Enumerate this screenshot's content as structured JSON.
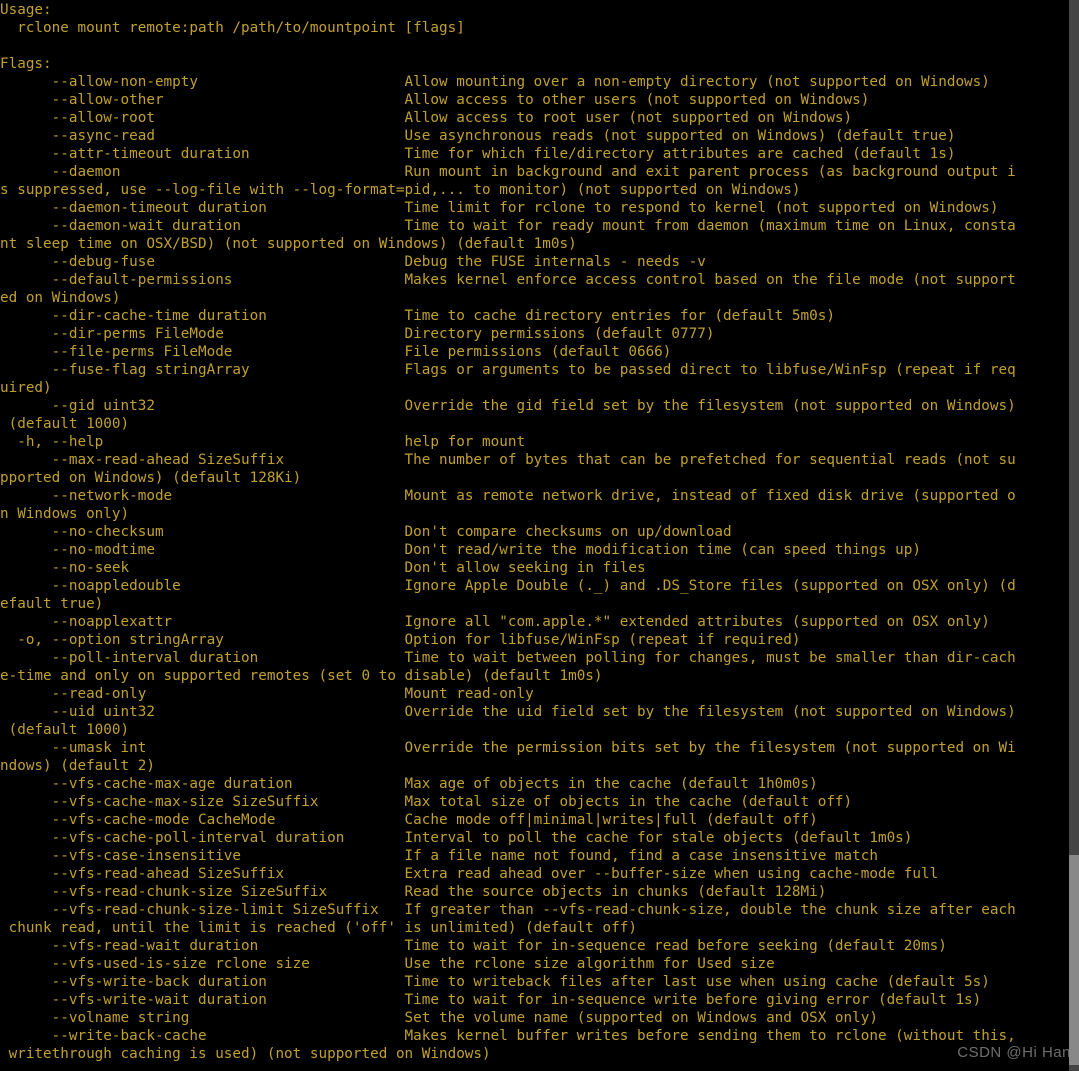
{
  "usage_header": "Usage:",
  "usage_body": "  rclone mount remote:path /path/to/mountpoint [flags]",
  "flags_header": "Flags:",
  "flags": [
    {
      "opt": "      --allow-non-empty",
      "desc": "Allow mounting over a non-empty directory (not supported on Windows)"
    },
    {
      "opt": "      --allow-other",
      "desc": "Allow access to other users (not supported on Windows)"
    },
    {
      "opt": "      --allow-root",
      "desc": "Allow access to root user (not supported on Windows)"
    },
    {
      "opt": "      --async-read",
      "desc": "Use asynchronous reads (not supported on Windows) (default true)"
    },
    {
      "opt": "      --attr-timeout duration",
      "desc": "Time for which file/directory attributes are cached (default 1s)"
    },
    {
      "opt": "      --daemon",
      "desc": "Run mount in background and exit parent process (as background output is suppressed, use --log-file with --log-format=pid,... to monitor) (not supported on Windows)"
    },
    {
      "opt": "      --daemon-timeout duration",
      "desc": "Time limit for rclone to respond to kernel (not supported on Windows)"
    },
    {
      "opt": "      --daemon-wait duration",
      "desc": "Time to wait for ready mount from daemon (maximum time on Linux, constant sleep time on OSX/BSD) (not supported on Windows) (default 1m0s)"
    },
    {
      "opt": "      --debug-fuse",
      "desc": "Debug the FUSE internals - needs -v"
    },
    {
      "opt": "      --default-permissions",
      "desc": "Makes kernel enforce access control based on the file mode (not supported on Windows)"
    },
    {
      "opt": "      --dir-cache-time duration",
      "desc": "Time to cache directory entries for (default 5m0s)"
    },
    {
      "opt": "      --dir-perms FileMode",
      "desc": "Directory permissions (default 0777)"
    },
    {
      "opt": "      --file-perms FileMode",
      "desc": "File permissions (default 0666)"
    },
    {
      "opt": "      --fuse-flag stringArray",
      "desc": "Flags or arguments to be passed direct to libfuse/WinFsp (repeat if required)"
    },
    {
      "opt": "      --gid uint32",
      "desc": "Override the gid field set by the filesystem (not supported on Windows) (default 1000)"
    },
    {
      "opt": "  -h, --help",
      "desc": "help for mount"
    },
    {
      "opt": "      --max-read-ahead SizeSuffix",
      "desc": "The number of bytes that can be prefetched for sequential reads (not supported on Windows) (default 128Ki)"
    },
    {
      "opt": "      --network-mode",
      "desc": "Mount as remote network drive, instead of fixed disk drive (supported on Windows only)"
    },
    {
      "opt": "      --no-checksum",
      "desc": "Don't compare checksums on up/download"
    },
    {
      "opt": "      --no-modtime",
      "desc": "Don't read/write the modification time (can speed things up)"
    },
    {
      "opt": "      --no-seek",
      "desc": "Don't allow seeking in files"
    },
    {
      "opt": "      --noappledouble",
      "desc": "Ignore Apple Double (._) and .DS_Store files (supported on OSX only) (default true)"
    },
    {
      "opt": "      --noapplexattr",
      "desc": "Ignore all \"com.apple.*\" extended attributes (supported on OSX only)"
    },
    {
      "opt": "  -o, --option stringArray",
      "desc": "Option for libfuse/WinFsp (repeat if required)"
    },
    {
      "opt": "      --poll-interval duration",
      "desc": "Time to wait between polling for changes, must be smaller than dir-cache-time and only on supported remotes (set 0 to disable) (default 1m0s)"
    },
    {
      "opt": "      --read-only",
      "desc": "Mount read-only"
    },
    {
      "opt": "      --uid uint32",
      "desc": "Override the uid field set by the filesystem (not supported on Windows) (default 1000)"
    },
    {
      "opt": "      --umask int",
      "desc": "Override the permission bits set by the filesystem (not supported on Windows) (default 2)"
    },
    {
      "opt": "      --vfs-cache-max-age duration",
      "desc": "Max age of objects in the cache (default 1h0m0s)"
    },
    {
      "opt": "      --vfs-cache-max-size SizeSuffix",
      "desc": "Max total size of objects in the cache (default off)"
    },
    {
      "opt": "      --vfs-cache-mode CacheMode",
      "desc": "Cache mode off|minimal|writes|full (default off)"
    },
    {
      "opt": "      --vfs-cache-poll-interval duration",
      "desc": "Interval to poll the cache for stale objects (default 1m0s)"
    },
    {
      "opt": "      --vfs-case-insensitive",
      "desc": "If a file name not found, find a case insensitive match"
    },
    {
      "opt": "      --vfs-read-ahead SizeSuffix",
      "desc": "Extra read ahead over --buffer-size when using cache-mode full"
    },
    {
      "opt": "      --vfs-read-chunk-size SizeSuffix",
      "desc": "Read the source objects in chunks (default 128Mi)"
    },
    {
      "opt": "      --vfs-read-chunk-size-limit SizeSuffix",
      "desc": "If greater than --vfs-read-chunk-size, double the chunk size after each chunk read, until the limit is reached ('off' is unlimited) (default off)"
    },
    {
      "opt": "      --vfs-read-wait duration",
      "desc": "Time to wait for in-sequence read before seeking (default 20ms)"
    },
    {
      "opt": "      --vfs-used-is-size rclone size",
      "desc": "Use the rclone size algorithm for Used size"
    },
    {
      "opt": "      --vfs-write-back duration",
      "desc": "Time to writeback files after last use when using cache (default 5s)"
    },
    {
      "opt": "      --vfs-write-wait duration",
      "desc": "Time to wait for in-sequence write before giving error (default 1s)"
    },
    {
      "opt": "      --volname string",
      "desc": "Set the volume name (supported on Windows and OSX only)"
    },
    {
      "opt": "      --write-back-cache",
      "desc": "Makes kernel buffer writes before sending them to rclone (without this, writethrough caching is used) (not supported on Windows)"
    }
  ],
  "watermark": "CSDN @Hi Han"
}
